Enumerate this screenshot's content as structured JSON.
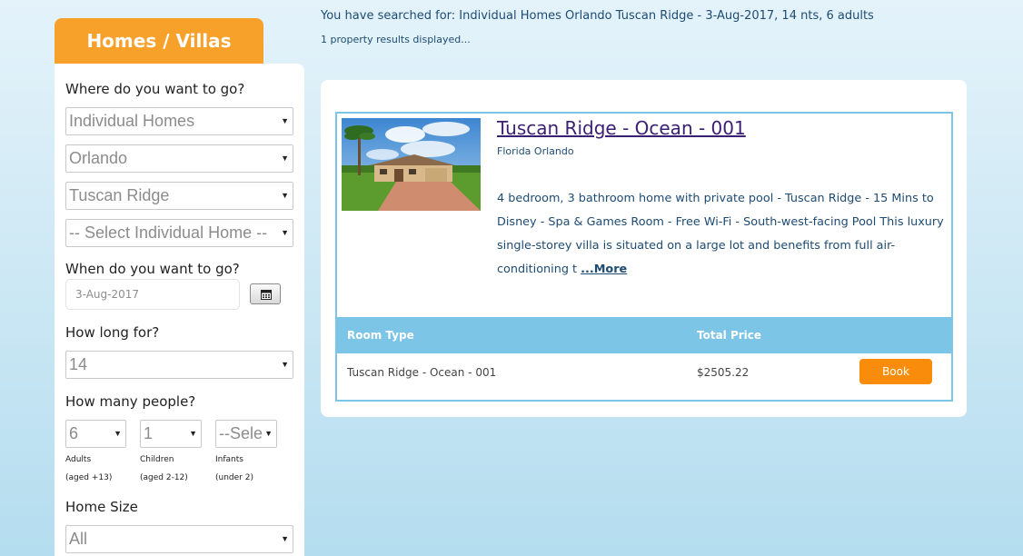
{
  "sidebar": {
    "tab_title": "Homes / Villas",
    "where_label": "Where do you want to go?",
    "category_select": "Individual Homes",
    "city_select": "Orlando",
    "resort_select": "Tuscan Ridge",
    "home_select": "-- Select Individual Home --",
    "when_label": "When do you want to go?",
    "date_value": "3-Aug-2017",
    "duration_label": "How long for?",
    "duration_select": "14",
    "people_label": "How many people?",
    "adults_select": "6",
    "children_select": "1",
    "infants_select": "--Sele",
    "adults_label": "Adults",
    "adults_note": "(aged +13)",
    "children_label": "Children",
    "children_note": "(aged 2-12)",
    "infants_label": "Infants",
    "infants_note": "(under 2)",
    "size_label": "Home Size",
    "size_select": "All"
  },
  "main": {
    "search_summary": "You have searched for: Individual Homes Orlando Tuscan Ridge - 3-Aug-2017, 14 nts, 6 adults",
    "results_count": "1 property results displayed...",
    "property": {
      "title": "Tuscan Ridge - Ocean - 001",
      "location": "Florida Orlando",
      "description": "4 bedroom, 3 bathroom home with private pool - Tuscan Ridge - 15 Mins to Disney - Spa & Games Room - Free Wi-Fi - South-west-facing Pool This luxury single-storey villa is situated on a large lot and benefits from full air-conditioning t ",
      "more_link": "...More"
    },
    "rooms": {
      "col_room_type": "Room Type",
      "col_total_price": "Total Price",
      "rows": [
        {
          "room_type": "Tuscan Ridge - Ocean - 001",
          "price": "$2505.22",
          "book_label": "Book"
        }
      ]
    }
  },
  "icons": {
    "dropdown": "triangle-down-icon",
    "calendar": "calendar-icon"
  },
  "colors": {
    "accent_orange": "#f7a12b",
    "book_button": "#f98c0a",
    "table_header": "#7cc5e6",
    "title_purple": "#3b1f72",
    "text_blue": "#1d4b73"
  }
}
